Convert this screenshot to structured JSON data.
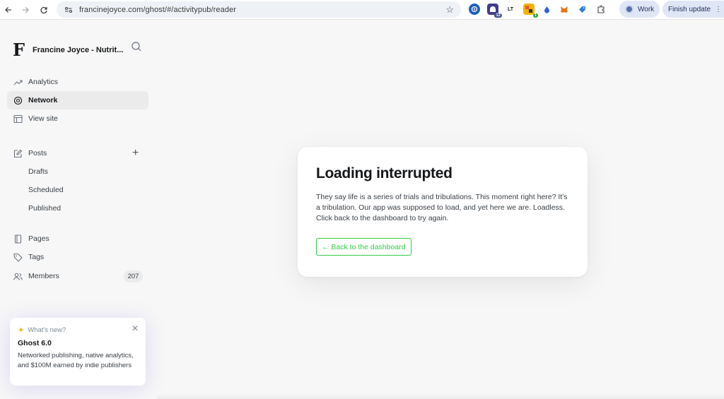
{
  "browser": {
    "url": "francinejoyce.com/ghost/#/activitypub/reader",
    "extension_badges": {
      "twelve": "12",
      "one": "1",
      "lt": "LT"
    },
    "profile_label": "Work",
    "update_label": "Finish update"
  },
  "sidebar": {
    "site_logo": "F",
    "site_title": "Francine Joyce - Nutrit...",
    "items": {
      "analytics": "Analytics",
      "network": "Network",
      "view_site": "View site",
      "posts": "Posts",
      "drafts": "Drafts",
      "scheduled": "Scheduled",
      "published": "Published",
      "pages": "Pages",
      "tags": "Tags",
      "members": "Members"
    },
    "members_count": "207",
    "whats_new": {
      "kicker": "What's new?",
      "title": "Ghost 6.0",
      "body": "Networked publishing, native analytics, and $100M earned by indie publishers"
    }
  },
  "main": {
    "title": "Loading interrupted",
    "message": "They say life is a series of trials and tribulations. This moment right here? It's a tribulation. Our app was supposed to load, and yet here we are. Loadless. Click back to the dashboard to try again.",
    "back_button": "← Back to the dashboard"
  },
  "colors": {
    "accent_green": "#30cf43",
    "active_bg": "#ebebeb"
  }
}
